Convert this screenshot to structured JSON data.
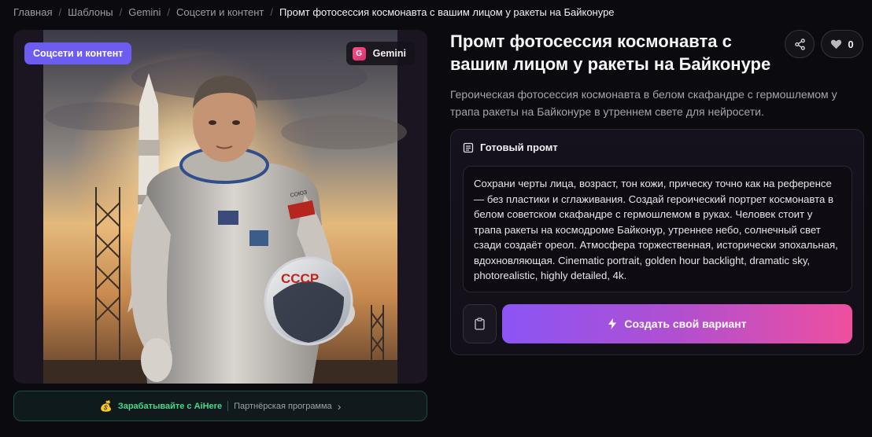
{
  "breadcrumb": {
    "items": [
      "Главная",
      "Шаблоны",
      "Gemini",
      "Соцсети и контент"
    ],
    "current": "Промт фотосессия космонавта с вашим лицом у ракеты на Байконуре",
    "separator": "/"
  },
  "image": {
    "category_badge": "Соцсети и контент",
    "model_badge": "Gemini",
    "model_logo": "G",
    "suit_patch_text": "СССР",
    "suit_label": "СОЮЗ"
  },
  "partner": {
    "earn_label": "Зарабатывайте с AiHere",
    "program_label": "Партнёрская программа"
  },
  "title": "Промт фотосессия космонавта с вашим лицом у ракеты на Байконуре",
  "like_count": "0",
  "description": "Героическая фотосессия космонавта в белом скафандре с гермошлемом у трапа ракеты на Байконуре в утреннем свете для нейросети.",
  "prompt": {
    "heading": "Готовый промт",
    "text": "Сохрани черты лица, возраст, тон кожи, прическу точно как на референсе — без пластики и сглаживания. Создай героический портрет космонавта в белом советском скафандре с гермошлемом в руках. Человек стоит у трапа ракеты на космодроме Байконур, утреннее небо, солнечный свет сзади создаёт ореол. Атмосфера торжественная, исторически эпохальная, вдохновляющая. Cinematic portrait, golden hour backlight, dramatic sky, photorealistic, highly detailed, 4k.",
    "create_label": "Создать свой вариант"
  },
  "icons": {
    "share": "share-icon",
    "heart": "heart-icon",
    "document": "document-icon",
    "clipboard": "clipboard-icon",
    "bolt": "bolt-icon",
    "coin": "coin-icon",
    "chevron": "chevron-right-icon"
  },
  "colors": {
    "accent": "#6d5cf0",
    "gradient_start": "#8b55f5",
    "gradient_end": "#ef4f9e",
    "partner_green": "#46d98c"
  }
}
